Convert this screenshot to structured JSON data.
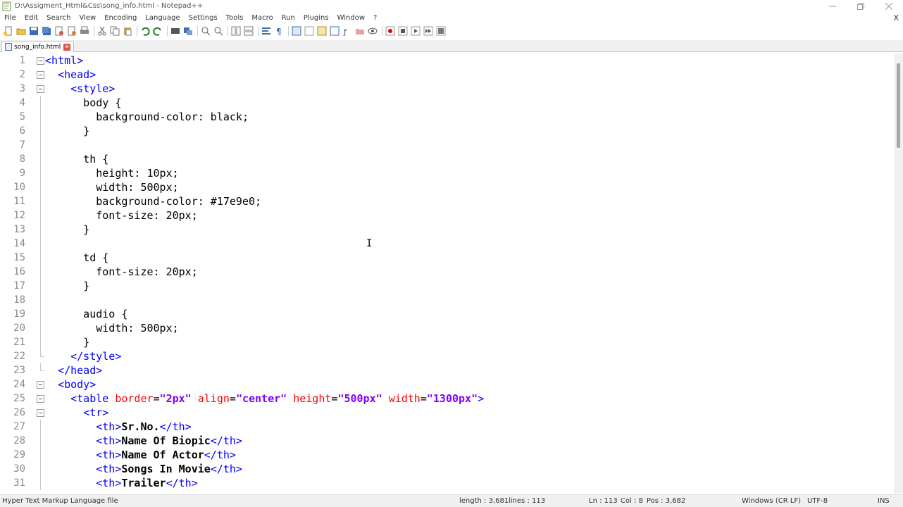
{
  "window": {
    "title": "D:\\Assigment_Html&Css\\song_info.html - Notepad++"
  },
  "menu": [
    "File",
    "Edit",
    "Search",
    "View",
    "Encoding",
    "Language",
    "Settings",
    "Tools",
    "Macro",
    "Run",
    "Plugins",
    "Window",
    "?"
  ],
  "menu_close": "X",
  "tab": {
    "label": "song_info.html"
  },
  "editor": {
    "line_numbers": [
      "1",
      "2",
      "3",
      "4",
      "5",
      "6",
      "7",
      "8",
      "9",
      "10",
      "11",
      "12",
      "13",
      "14",
      "15",
      "16",
      "17",
      "18",
      "19",
      "20",
      "21",
      "22",
      "23",
      "24",
      "25",
      "26",
      "27",
      "28",
      "29",
      "30",
      "31"
    ],
    "lines": [
      {
        "s": [
          [
            "tag",
            "<html>"
          ]
        ]
      },
      {
        "s": [
          [
            "txt",
            "  "
          ],
          [
            "tag",
            "<head>"
          ]
        ]
      },
      {
        "s": [
          [
            "txt",
            "    "
          ],
          [
            "tag",
            "<style>"
          ]
        ]
      },
      {
        "s": [
          [
            "txt",
            "      body {"
          ]
        ]
      },
      {
        "s": [
          [
            "txt",
            "        background-color: black;"
          ]
        ]
      },
      {
        "s": [
          [
            "txt",
            "      }"
          ]
        ]
      },
      {
        "s": []
      },
      {
        "s": [
          [
            "txt",
            "      th {"
          ]
        ]
      },
      {
        "s": [
          [
            "txt",
            "        height: 10px;"
          ]
        ]
      },
      {
        "s": [
          [
            "txt",
            "        width: 500px;"
          ]
        ]
      },
      {
        "s": [
          [
            "txt",
            "        background-color: #17e9e0;"
          ]
        ]
      },
      {
        "s": [
          [
            "txt",
            "        font-size: 20px;"
          ]
        ]
      },
      {
        "s": [
          [
            "txt",
            "      }"
          ]
        ]
      },
      {
        "s": []
      },
      {
        "s": [
          [
            "txt",
            "      td {"
          ]
        ]
      },
      {
        "s": [
          [
            "txt",
            "        font-size: 20px;"
          ]
        ]
      },
      {
        "s": [
          [
            "txt",
            "      }"
          ]
        ]
      },
      {
        "s": []
      },
      {
        "s": [
          [
            "txt",
            "      audio {"
          ]
        ]
      },
      {
        "s": [
          [
            "txt",
            "        width: 500px;"
          ]
        ]
      },
      {
        "s": [
          [
            "txt",
            "      }"
          ]
        ]
      },
      {
        "s": [
          [
            "txt",
            "    "
          ],
          [
            "tag",
            "</style>"
          ]
        ]
      },
      {
        "s": [
          [
            "txt",
            "  "
          ],
          [
            "tag",
            "</head>"
          ]
        ]
      },
      {
        "s": [
          [
            "txt",
            "  "
          ],
          [
            "tag",
            "<body>"
          ]
        ]
      },
      {
        "s": [
          [
            "txt",
            "    "
          ],
          [
            "tag",
            "<table "
          ],
          [
            "attr",
            "border"
          ],
          [
            "txt",
            "="
          ],
          [
            "val",
            "\"2px\""
          ],
          [
            "txt",
            " "
          ],
          [
            "attr",
            "align"
          ],
          [
            "txt",
            "="
          ],
          [
            "val",
            "\"center\""
          ],
          [
            "txt",
            " "
          ],
          [
            "attr",
            "height"
          ],
          [
            "txt",
            "="
          ],
          [
            "val",
            "\"500px\""
          ],
          [
            "txt",
            " "
          ],
          [
            "attr",
            "width"
          ],
          [
            "txt",
            "="
          ],
          [
            "val",
            "\"1300px\""
          ],
          [
            "tag",
            ">"
          ]
        ]
      },
      {
        "s": [
          [
            "txt",
            "      "
          ],
          [
            "tag",
            "<tr>"
          ]
        ]
      },
      {
        "s": [
          [
            "txt",
            "        "
          ],
          [
            "tag",
            "<th>"
          ],
          [
            "bold",
            "Sr.No."
          ],
          [
            "tag",
            "</th>"
          ]
        ]
      },
      {
        "s": [
          [
            "txt",
            "        "
          ],
          [
            "tag",
            "<th>"
          ],
          [
            "bold",
            "Name Of Biopic"
          ],
          [
            "tag",
            "</th>"
          ]
        ]
      },
      {
        "s": [
          [
            "txt",
            "        "
          ],
          [
            "tag",
            "<th>"
          ],
          [
            "bold",
            "Name Of Actor"
          ],
          [
            "tag",
            "</th>"
          ]
        ]
      },
      {
        "s": [
          [
            "txt",
            "        "
          ],
          [
            "tag",
            "<th>"
          ],
          [
            "bold",
            "Songs In Movie"
          ],
          [
            "tag",
            "</th>"
          ]
        ]
      },
      {
        "s": [
          [
            "txt",
            "        "
          ],
          [
            "tag",
            "<th>"
          ],
          [
            "bold",
            "Trailer"
          ],
          [
            "tag",
            "</th>"
          ]
        ]
      }
    ],
    "fold_markers": [
      "minus",
      "minus",
      "minus",
      "line",
      "line",
      "line",
      "line",
      "line",
      "line",
      "line",
      "line",
      "line",
      "line",
      "line",
      "line",
      "line",
      "line",
      "line",
      "line",
      "line",
      "line",
      "end",
      "end",
      "minus",
      "minus",
      "minus",
      "line",
      "line",
      "line",
      "line",
      "line"
    ]
  },
  "status": {
    "file_type": "Hyper Text Markup Language file",
    "length": "length : 3,681",
    "lines": "lines : 113",
    "ln": "Ln : 113",
    "col": "Col : 8",
    "pos": "Pos : 3,682",
    "eol": "Windows (CR LF)",
    "encoding": "UTF-8",
    "mode": "INS"
  },
  "colors": {
    "tag": "#0000ff",
    "attr": "#ff0000",
    "attr_value": "#8000ff",
    "text": "#000000",
    "line_number": "#8a8a8a"
  }
}
